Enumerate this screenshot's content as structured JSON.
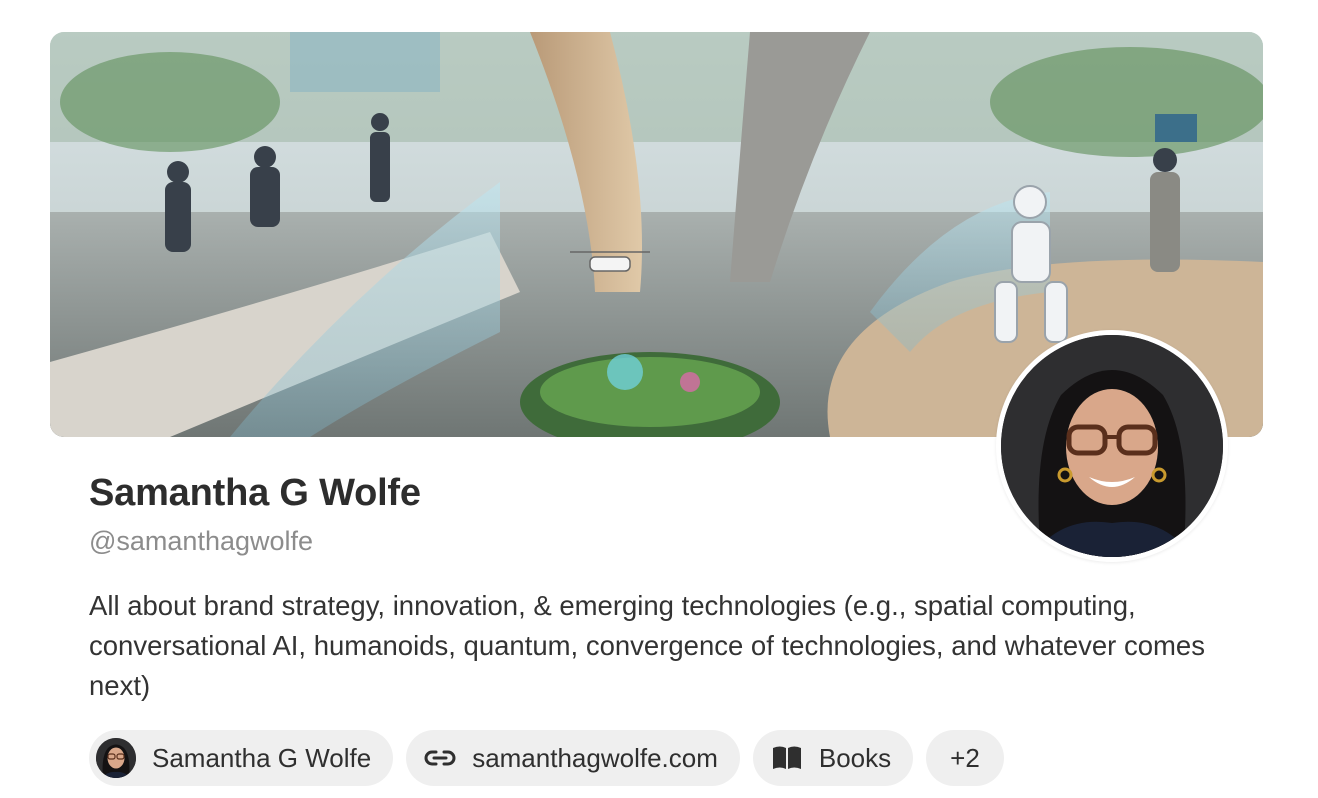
{
  "profile": {
    "name": "Samantha G Wolfe",
    "handle": "@samanthagwolfe",
    "bio": "All about brand strategy, innovation, & emerging technologies (e.g., spatial computing, conversational AI, humanoids, quantum, convergence of technologies, and whatever comes next)"
  },
  "chips": {
    "profile_label": "Samantha G Wolfe",
    "website_label": "samanthagwolfe.com",
    "books_label": "Books",
    "more_label": "+2"
  },
  "icons": {
    "website": "link-icon",
    "books": "book-icon"
  },
  "colors": {
    "chip_bg": "#efefef",
    "handle": "#8c8c8c"
  }
}
